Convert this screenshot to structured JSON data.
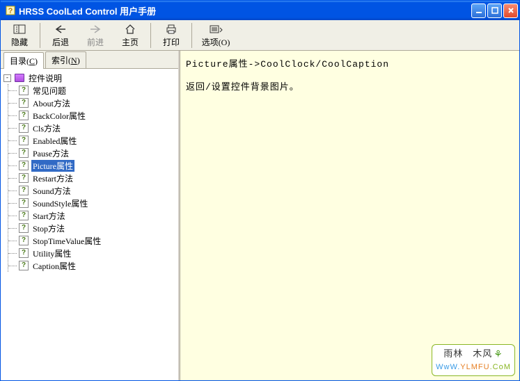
{
  "window": {
    "title": "HRSS CoolLed Control 用户手册"
  },
  "toolbar": {
    "hide": "隐藏",
    "back": "后退",
    "forward": "前进",
    "home": "主页",
    "print": "打印",
    "options": "选项(O)"
  },
  "tabs": {
    "contents": {
      "label": "目录",
      "key": "C"
    },
    "index": {
      "label": "索引",
      "key": "N"
    }
  },
  "tree": {
    "root": "控件说明",
    "items": [
      "常见问题",
      "About方法",
      "BackColor属性",
      "Cls方法",
      "Enabled属性",
      "Pause方法",
      "Picture属性",
      "Restart方法",
      "Sound方法",
      "SoundStyle属性",
      "Start方法",
      "Stop方法",
      "StopTimeValue属性",
      "Utility属性",
      "Caption属性"
    ],
    "selected_index": 6
  },
  "content": {
    "title": "Picture属性->CoolClock/CoolCaption",
    "body": "返回/设置控件背景图片。"
  },
  "watermark": {
    "line1": "雨林　木风",
    "line2_w": "WwW.",
    "line2_y": "YLMFU",
    "line2_c": ".CoM"
  }
}
